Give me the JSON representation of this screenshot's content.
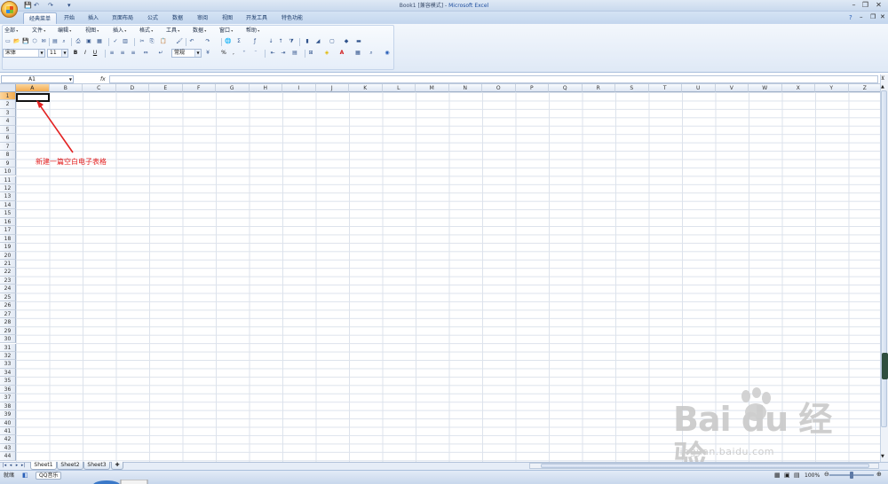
{
  "title": {
    "doc": "Book1",
    "mode": "[兼容模式]",
    "separator": " - ",
    "app": "Microsoft Excel"
  },
  "tabs": [
    {
      "label": "经典菜单",
      "active": true
    },
    {
      "label": "开始"
    },
    {
      "label": "插入"
    },
    {
      "label": "页面布局"
    },
    {
      "label": "公式"
    },
    {
      "label": "数据"
    },
    {
      "label": "审阅"
    },
    {
      "label": "视图"
    },
    {
      "label": "开发工具"
    },
    {
      "label": "特色功能"
    }
  ],
  "menu": [
    "全部",
    "文件",
    "编辑",
    "视图",
    "插入",
    "格式",
    "工具",
    "数据",
    "窗口",
    "帮助"
  ],
  "toolbar": {
    "font_name": "宋体",
    "font_size": "11",
    "number_format": "常规",
    "bold": "B",
    "italic": "I",
    "underline": "U",
    "percent": "%",
    "comma": ","
  },
  "formula_bar": {
    "name_box": "A1",
    "fx": "fx",
    "value": ""
  },
  "columns": [
    "A",
    "B",
    "C",
    "D",
    "E",
    "F",
    "G",
    "H",
    "I",
    "J",
    "K",
    "L",
    "M",
    "N",
    "O",
    "P",
    "Q",
    "R",
    "S",
    "T",
    "U",
    "V",
    "W",
    "X",
    "Y",
    "Z"
  ],
  "rows": [
    "1",
    "2",
    "3",
    "4",
    "5",
    "6",
    "7",
    "8",
    "9",
    "10",
    "11",
    "12",
    "13",
    "14",
    "15",
    "16",
    "17",
    "18",
    "19",
    "20",
    "21",
    "22",
    "23",
    "24",
    "25",
    "26",
    "27",
    "28",
    "29",
    "30",
    "31",
    "32",
    "33",
    "34",
    "35",
    "36",
    "37",
    "38",
    "39",
    "40",
    "41",
    "42",
    "43",
    "44"
  ],
  "annotation": "新建一篇空白电子表格",
  "sheets": [
    {
      "label": "Sheet1",
      "active": true
    },
    {
      "label": "Sheet2"
    },
    {
      "label": "Sheet3"
    }
  ],
  "status": {
    "ready": "就绪",
    "qq": "QQ音乐",
    "zoom": "100%"
  },
  "watermark": {
    "brand": "Bai du 经验",
    "url": "jingyan.baidu.com"
  },
  "colors": {
    "accent": "#1e4e9e",
    "annotation": "#e32222",
    "selection": "#f3aa4d"
  }
}
